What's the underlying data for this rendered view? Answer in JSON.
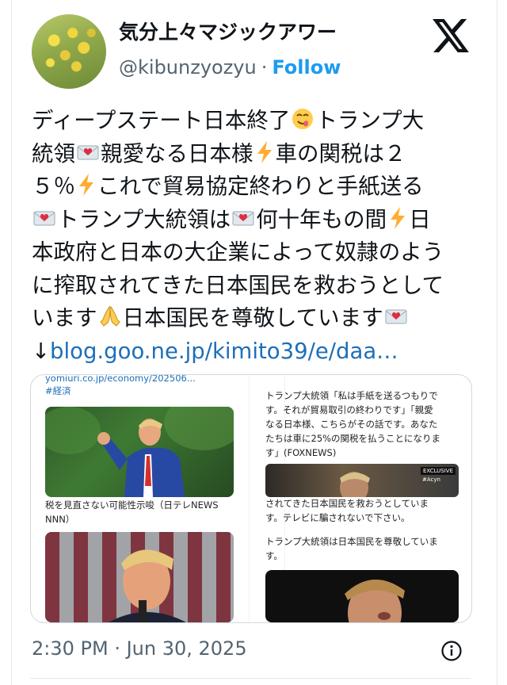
{
  "author": {
    "display_name": "気分上々マジックアワー",
    "handle": "@kibunzyozyu",
    "separator": "·",
    "follow_label": "Follow"
  },
  "tweet": {
    "lines": [
      "ディープステート日本終了",
      "統領",
      "５％",
      "トランプ大統領は",
      "本政府と日本の大企業によって奴隷のよう",
      "に搾取されてきた日本国民を救おうとして",
      "います"
    ],
    "segments": {
      "l1b": "トランプ大",
      "l2b": "親愛なる日本様",
      "l2c": "車の関税は２",
      "l3b": "これで貿易協定終わりと手紙送る",
      "l4b": "何十年もの間",
      "l4c": "日",
      "l7b": "日本国民を尊敬しています"
    },
    "link_arrow": "↓",
    "link_text": "blog.goo.ne.jp/kimito39/e/daa…"
  },
  "media": {
    "left": {
      "url_snippet": "yomiuri.co.jp/economy/202506...",
      "tag": "#経済",
      "caption": "税を見直さない可能性示唆（日テレNEWS",
      "caption2": "NNN）"
    },
    "right": {
      "text_lines": [
        "トランプ大統領「私は手紙を送るつもりで",
        "す。それが貿易取引の終わりです」「親愛",
        "なる日本様、こちらがその話です。あなた",
        "たちは車に25%の関税を払うことになりま",
        "す」(FOXNEWS)"
      ],
      "mid_lines": [
        "されてきた日本国民を救おうとしていま",
        "す。テレビに騙されないで下さい。"
      ],
      "bottom_line": "トランプ大統領は日本国民を尊敬していま",
      "bottom_line2": "す。",
      "badge": "EXCLUSIVE",
      "badge2": "#Acyn"
    }
  },
  "meta": {
    "timestamp": "2:30 PM · Jun 30, 2025"
  },
  "icons": {
    "brand": "x-logo-icon",
    "info": "info-icon",
    "emojis": [
      "yum-face-icon",
      "love-letter-icon",
      "lightning-icon",
      "praying-hands-icon"
    ]
  },
  "colors": {
    "follow": "#1d9bf0",
    "link": "#1d6fb8",
    "secondary_text": "#536471"
  }
}
